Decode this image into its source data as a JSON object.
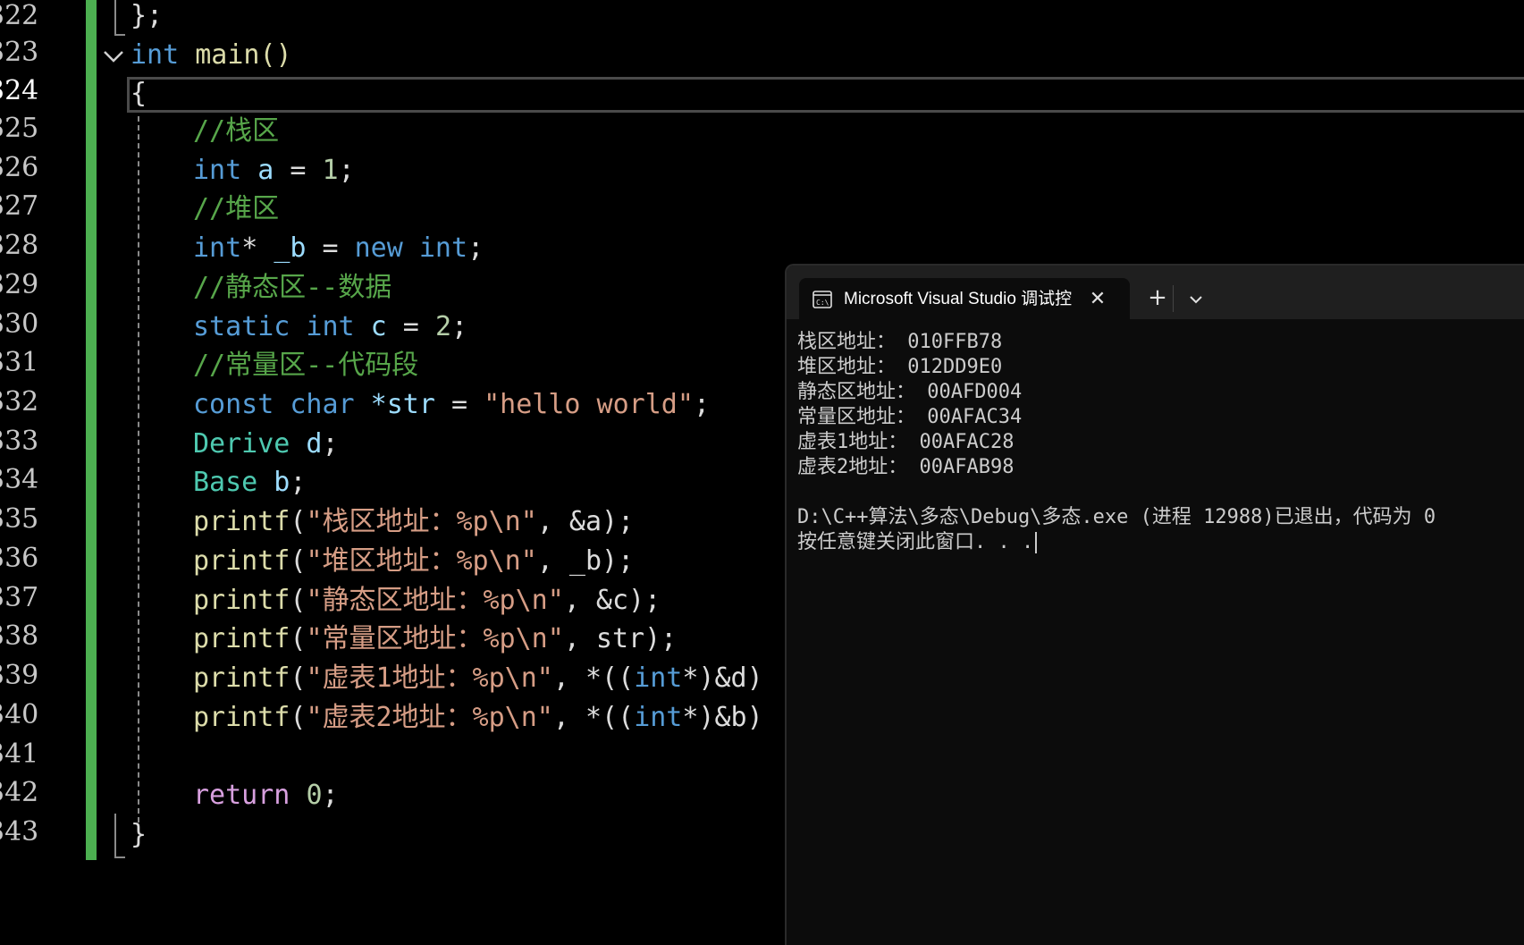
{
  "editor": {
    "line_numbers": [
      "322",
      "323",
      "324",
      "325",
      "326",
      "327",
      "328",
      "329",
      "330",
      "331",
      "332",
      "333",
      "334",
      "335",
      "336",
      "337",
      "338",
      "339",
      "340",
      "341",
      "342",
      "343"
    ],
    "active_line": "324",
    "code": {
      "l322": "};",
      "l323_kw": "int",
      "l323_rest": " main()",
      "l324": "{",
      "l325": "//栈区",
      "l326_kw": "int",
      "l326_var": " a",
      "l326_eq": " = ",
      "l326_num": "1",
      "l326_end": ";",
      "l327": "//堆区",
      "l328_kw": "int",
      "l328_star": "* ",
      "l328_var": "_b",
      "l328_eq": " = ",
      "l328_new": "new",
      "l328_sp": " ",
      "l328_kw2": "int",
      "l328_end": ";",
      "l329": "//静态区--数据",
      "l330_kw": "static int",
      "l330_var": " c",
      "l330_eq": " = ",
      "l330_num": "2",
      "l330_end": ";",
      "l331": "//常量区--代码段",
      "l332_kw": "const char",
      "l332_var": " *str",
      "l332_eq": " = ",
      "l332_str": "\"hello world\"",
      "l332_end": ";",
      "l333_type": "Derive",
      "l333_var": " d",
      "l333_end": ";",
      "l334_type": "Base",
      "l334_var": " b",
      "l334_end": ";",
      "l335_fn": "printf",
      "l335_open": "(",
      "l335_str": "\"栈区地址：%p\\n\"",
      "l335_rest": ", &a);",
      "l336_fn": "printf",
      "l336_open": "(",
      "l336_str": "\"堆区地址：%p\\n\"",
      "l336_rest": ", _b);",
      "l337_fn": "printf",
      "l337_open": "(",
      "l337_str": "\"静态区地址：%p\\n\"",
      "l337_rest": ", &c);",
      "l338_fn": "printf",
      "l338_open": "(",
      "l338_str": "\"常量区地址：%p\\n\"",
      "l338_rest": ", str);",
      "l339_fn": "printf",
      "l339_open": "(",
      "l339_str": "\"虚表1地址：%p\\n\"",
      "l339_mid": ", *((",
      "l339_kw": "int",
      "l339_rest": "*)&d)",
      "l340_fn": "printf",
      "l340_open": "(",
      "l340_str": "\"虚表2地址：%p\\n\"",
      "l340_mid": ", *((",
      "l340_kw": "int",
      "l340_rest": "*)&b)",
      "l342_kw": "return",
      "l342_sp": " ",
      "l342_num": "0",
      "l342_end": ";",
      "l343": "}"
    }
  },
  "console": {
    "tab_title": "Microsoft Visual Studio 调试控",
    "tab_icon": "terminal-icon",
    "close_glyph": "✕",
    "new_tab_glyph": "+",
    "dropdown_icon": "chevron-down-icon",
    "output": [
      "栈区地址： 010FFB78",
      "堆区地址： 012DD9E0",
      "静态区地址： 00AFD004",
      "常量区地址： 00AFAC34",
      "虚表1地址： 00AFAC28",
      "虚表2地址： 00AFAB98",
      "",
      "D:\\C++算法\\多态\\Debug\\多态.exe (进程 12988)已退出，代码为 0",
      "按任意键关闭此窗口. . ."
    ]
  },
  "colors": {
    "background": "#000000",
    "keyword": "#569cd6",
    "comment": "#57a64a",
    "string": "#d69d85",
    "function": "#dcdcaa",
    "type": "#4ec9b0",
    "variable": "#9cdcfe",
    "number": "#b5cea8",
    "control_keyword": "#d8a0df",
    "change_bar": "#4caf50"
  }
}
